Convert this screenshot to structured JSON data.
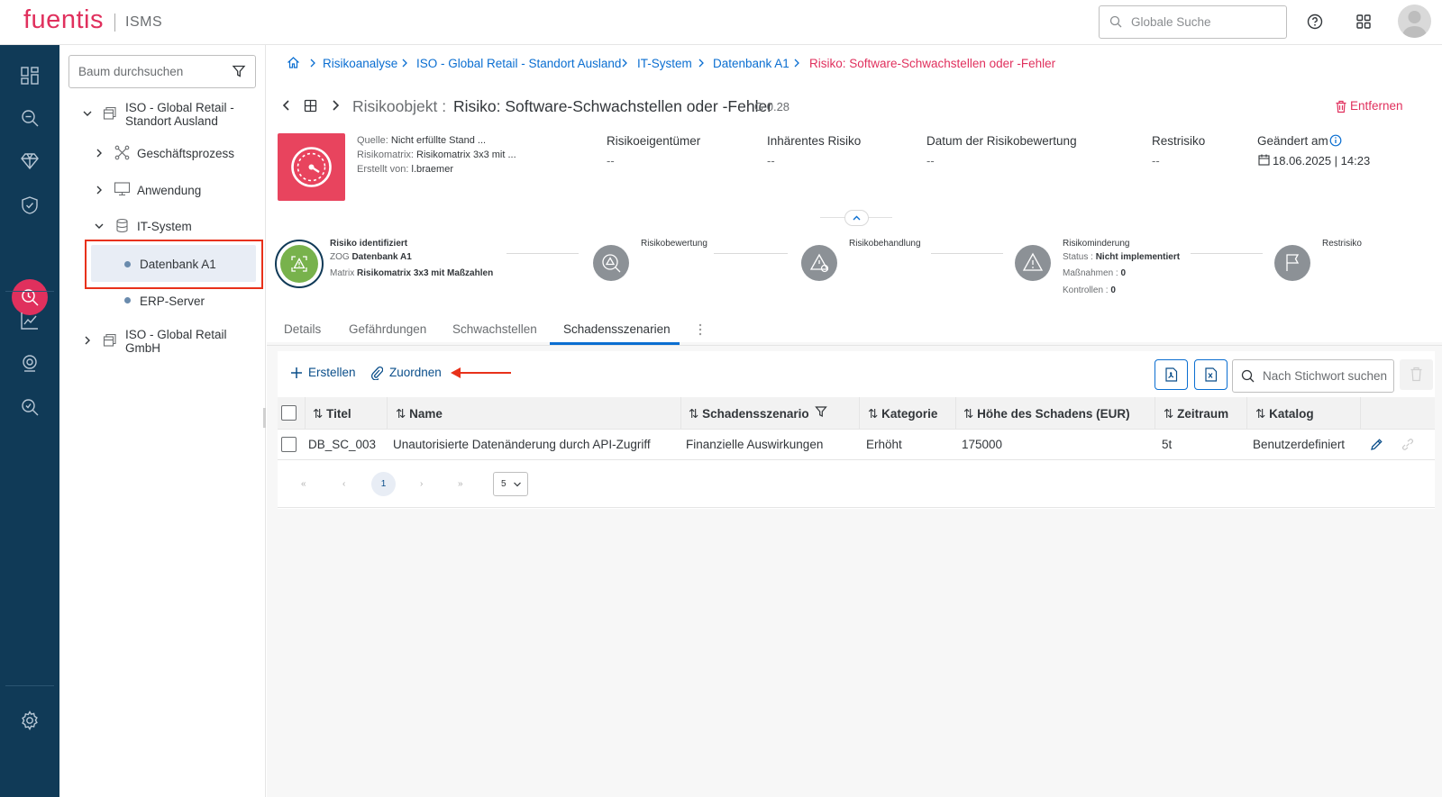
{
  "header": {
    "logo": "fuentis",
    "product": "ISMS",
    "search_placeholder": "Globale Suche"
  },
  "nav": {
    "items": [
      "dashboard-icon",
      "search-analysis-icon",
      "diamond-icon",
      "shield-icon",
      "risk-analysis-icon",
      "chart-icon",
      "location-icon",
      "audit-search-icon",
      "settings-icon"
    ],
    "active": "risk-analysis-icon"
  },
  "tree": {
    "search_placeholder": "Baum durchsuchen",
    "nodes": [
      {
        "label_1": "ISO - Global Retail -",
        "label_2": "Standort Ausland"
      },
      {
        "label": "Geschäftsprozess"
      },
      {
        "label": "Anwendung"
      },
      {
        "label": "IT-System"
      },
      {
        "label": "Datenbank A1"
      },
      {
        "label": "ERP-Server"
      },
      {
        "label_1": "ISO - Global Retail",
        "label_2": "GmbH"
      }
    ]
  },
  "breadcrumb": [
    "Risikoanalyse",
    "ISO - Global Retail - Standort Ausland",
    "IT-System",
    "Datenbank A1",
    "Risiko: Software-Schwachstellen oder -Fehler"
  ],
  "object": {
    "label": "Risikoobjekt :",
    "title": "Risiko: Software-Schwachstellen oder -Fehler",
    "version": "G 0.28",
    "remove_label": "Entfernen",
    "source_key": "Quelle:",
    "source_val": "Nicht erfüllte Stand ...",
    "matrix_key": "Risikomatrix:",
    "matrix_val": "Risikomatrix 3x3 mit ...",
    "created_key": "Erstellt von:",
    "created_val": "l.braemer",
    "columns": [
      {
        "label": "Risikoeigentümer",
        "value": "--"
      },
      {
        "label": "Inhärentes Risiko",
        "value": "--"
      },
      {
        "label": "Datum der Risikobewertung",
        "value": "--"
      },
      {
        "label": "Restrisiko",
        "value": "--"
      },
      {
        "label": "Geändert am",
        "value": "18.06.2025 | 14:23"
      }
    ]
  },
  "stepper": {
    "s1": {
      "title": "Risiko identifiziert",
      "l1k": "ZOG",
      "l1v": "Datenbank A1",
      "l2k": "Matrix",
      "l2v": "Risikomatrix 3x3 mit Maßzahlen"
    },
    "s2": {
      "title": "Risikobewertung"
    },
    "s3": {
      "title": "Risikobehandlung"
    },
    "s4": {
      "title": "Risikominderung",
      "status_k": "Status :",
      "status_v": "Nicht implementiert",
      "mass_k": "Maßnahmen :",
      "mass_v": "0",
      "kontr_k": "Kontrollen :",
      "kontr_v": "0"
    },
    "s5": {
      "title": "Restrisiko"
    }
  },
  "tabs": [
    "Details",
    "Gefährdungen",
    "Schwachstellen",
    "Schadensszenarien"
  ],
  "active_tab": "Schadensszenarien",
  "toolbar": {
    "create": "Erstellen",
    "assign": "Zuordnen",
    "search_placeholder": "Nach Stichwort suchen"
  },
  "table": {
    "columns": [
      "Titel",
      "Name",
      "Schadensszenario",
      "Kategorie",
      "Höhe des Schadens (EUR)",
      "Zeitraum",
      "Katalog"
    ],
    "rows": [
      [
        "DB_SC_003",
        "Unautorisierte Datenänderung durch API-Zugriff",
        "Finanzielle Auswirkungen",
        "Erhöht",
        "175000",
        "5t",
        "Benutzerdefiniert"
      ]
    ]
  },
  "pagination": {
    "first": "«",
    "prev": "‹",
    "current": "1",
    "next": "›",
    "last": "»",
    "page_size": "5"
  },
  "colors": {
    "brand": "#e0305d",
    "nav_bg": "#103a57",
    "link": "#0a6ed1",
    "highlight_box": "#e8311a"
  }
}
